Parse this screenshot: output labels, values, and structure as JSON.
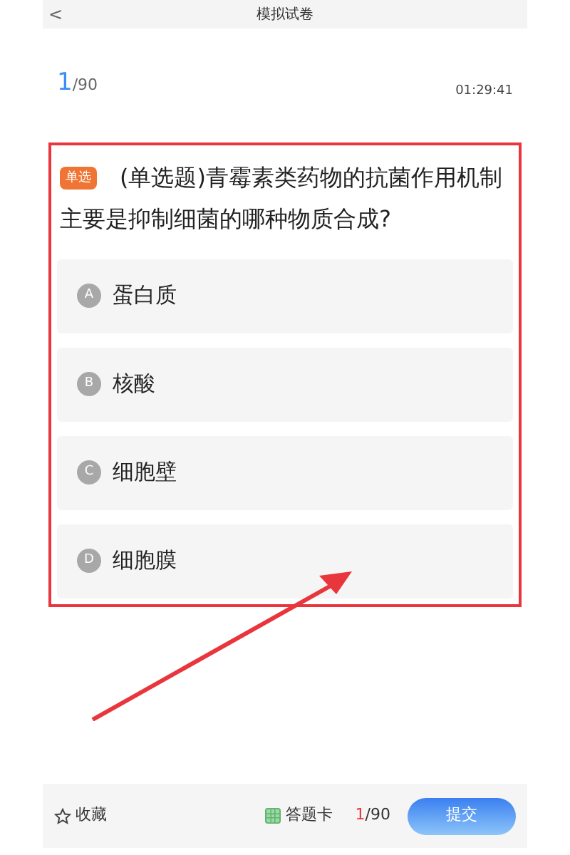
{
  "header": {
    "back": "<",
    "title": "模拟试卷"
  },
  "progress": {
    "current": "1",
    "total": "/90",
    "timer": "01:29:41"
  },
  "question": {
    "tag": "单选",
    "text": "(单选题)青霉素类药物的抗菌作用机制主要是抑制细菌的哪种物质合成?",
    "options": [
      {
        "letter": "A",
        "text": "蛋白质"
      },
      {
        "letter": "B",
        "text": "核酸"
      },
      {
        "letter": "C",
        "text": "细胞壁"
      },
      {
        "letter": "D",
        "text": "细胞膜"
      }
    ]
  },
  "footer": {
    "favorite": "收藏",
    "answer_card": "答题卡",
    "current": "1",
    "total": "/90",
    "submit": "提交"
  }
}
